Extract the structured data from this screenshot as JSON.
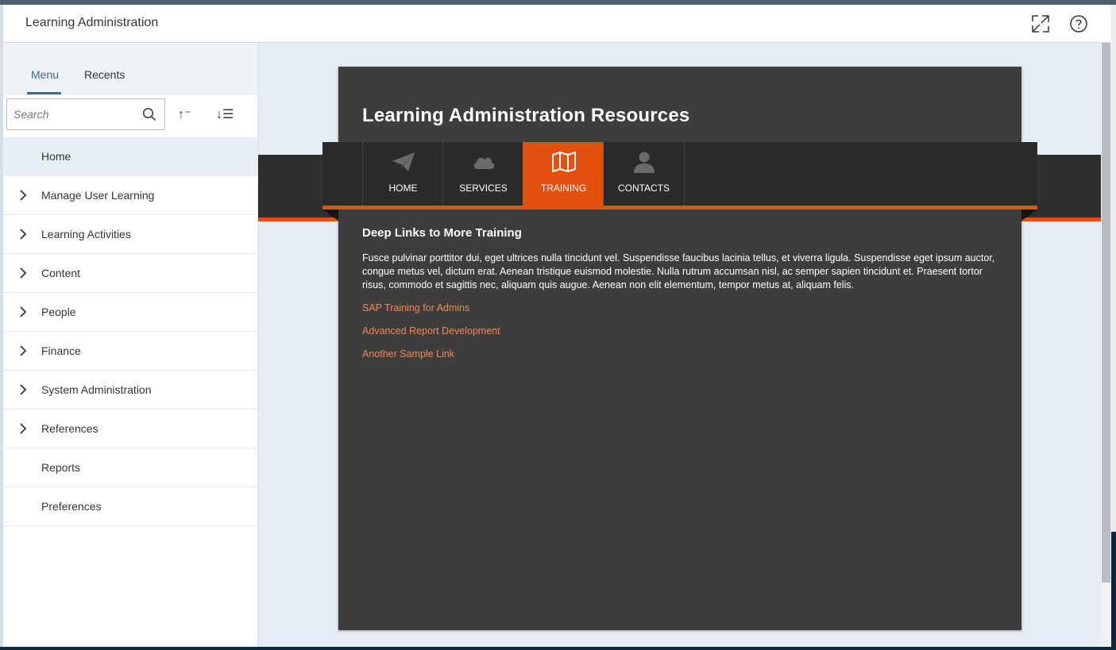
{
  "app": {
    "title": "Learning Administration"
  },
  "header": {
    "fullscreen_icon": "expand-icon",
    "help_icon": "help-icon"
  },
  "sidebar": {
    "tabs": [
      {
        "label": "Menu",
        "active": true
      },
      {
        "label": "Recents",
        "active": false
      }
    ],
    "search": {
      "placeholder": "Search",
      "value": ""
    },
    "tools": {
      "sort_up": "↑⁻",
      "sort_list": "↓☰"
    },
    "items": [
      {
        "label": "Home",
        "expandable": false,
        "selected": true
      },
      {
        "label": "Manage User Learning",
        "expandable": true
      },
      {
        "label": "Learning Activities",
        "expandable": true
      },
      {
        "label": "Content",
        "expandable": true
      },
      {
        "label": "People",
        "expandable": true
      },
      {
        "label": "Finance",
        "expandable": true
      },
      {
        "label": "System Administration",
        "expandable": true
      },
      {
        "label": "References",
        "expandable": true
      },
      {
        "label": "Reports",
        "expandable": false
      },
      {
        "label": "Preferences",
        "expandable": false
      }
    ]
  },
  "resources": {
    "title": "Learning Administration Resources",
    "nav": [
      {
        "label": "HOME",
        "icon": "paper-plane-icon"
      },
      {
        "label": "SERVICES",
        "icon": "cloud-icon"
      },
      {
        "label": "TRAINING",
        "icon": "map-icon",
        "active": true
      },
      {
        "label": "CONTACTS",
        "icon": "person-icon"
      }
    ],
    "section_title": "Deep Links to More Training",
    "body": "Fusce pulvinar porttitor dui, eget ultrices nulla tincidunt vel. Suspendisse faucibus lacinia tellus, et viverra ligula. Suspendisse eget ipsum auctor, congue metus vel, dictum erat. Aenean tristique euismod molestie. Nulla rutrum accumsan nisl, ac semper sapien tincidunt et. Praesent tortor risus, commodo et sagittis nec, aliquam quis augue. Aenean non elit elementum, tempor metus at, aliquam felis.",
    "links": [
      "SAP Training for Admins",
      "Advanced Report Development",
      "Another Sample Link"
    ]
  },
  "colors": {
    "accent": "#e4500e",
    "link": "#f0875a",
    "card": "#3d3d3b",
    "tab_active": "#3f6791"
  }
}
